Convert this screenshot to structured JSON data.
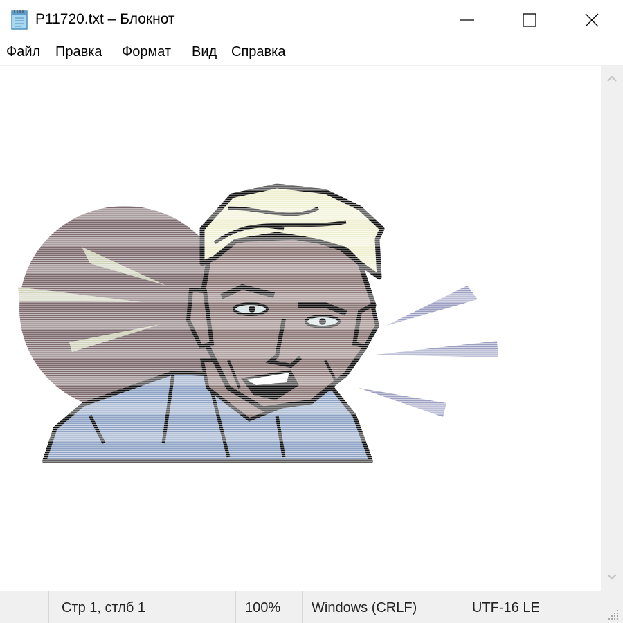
{
  "window": {
    "title": "P11720.txt – Блокнот",
    "app_icon": "notepad-icon",
    "controls": [
      "minimize-icon",
      "maximize-icon",
      "close-icon"
    ]
  },
  "menu": {
    "items": [
      {
        "label": "Файл"
      },
      {
        "label": "Правка"
      },
      {
        "label": "Формат"
      },
      {
        "label": "Вид"
      },
      {
        "label": "Справка"
      }
    ]
  },
  "editor": {
    "content": "ASCII-art illustration of a shouting man rendered in colored text lines"
  },
  "statusbar": {
    "position": "Стр 1, стлб 1",
    "zoom": "100%",
    "line_endings": "Windows (CRLF)",
    "encoding": "UTF-16 LE"
  },
  "colors": {
    "background": "#ffffff",
    "chrome": "#f0f0f0",
    "art_circle": "#7d6a6f",
    "art_skin": "#8d7878",
    "art_hair": "#efefd2",
    "art_shirt": "#8fa3c6",
    "art_rays_left": "#cfd1b8",
    "art_rays_right": "#9c9fc2"
  }
}
